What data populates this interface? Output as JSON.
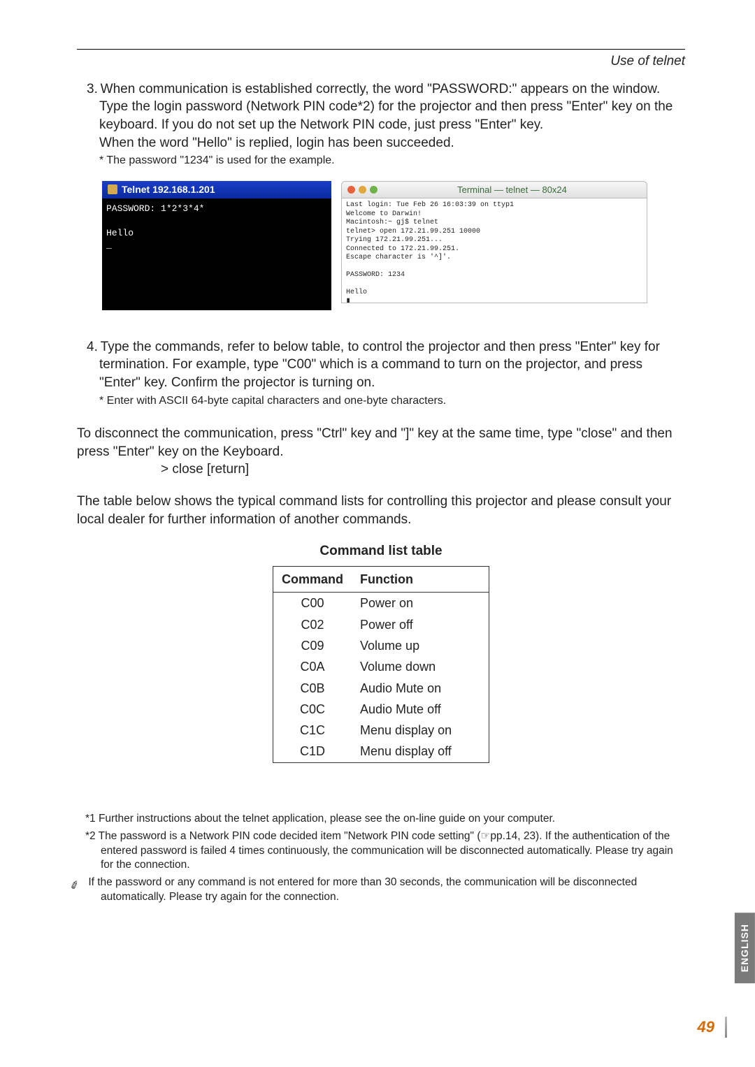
{
  "header": {
    "section": "Use of telnet"
  },
  "step3": {
    "text": "3. When communication is established correctly, the word \"PASSWORD:\" appears on the window. Type the login password (Network PIN code*2) for the projector and then press \"Enter\" key on the keyboard. If you do not set up the Network PIN code, just press \"Enter\" key.",
    "cont": "When the word \"Hello\" is replied, login has been succeeded.",
    "note": "* The password \"1234\" is used for the example."
  },
  "win_shot": {
    "title": "Telnet 192.168.1.201",
    "body": "PASSWORD: 1*2*3*4*\n\nHello\n_"
  },
  "mac_shot": {
    "title": "Terminal — telnet — 80x24",
    "body": "Last login: Tue Feb 26 16:03:39 on ttyp1\nWelcome to Darwin!\nMacintosh:~ gj$ telnet\ntelnet> open 172.21.99.251 10000\nTrying 172.21.99.251...\nConnected to 172.21.99.251.\nEscape character is '^]'.\n\nPASSWORD: 1234\n\nHello\n∎"
  },
  "step4": {
    "text": "4. Type the commands, refer to below table, to control the projector and then press \"Enter\" key for termination. For example, type \"C00\" which is a command to turn on the projector, and press \"Enter\" key. Confirm the projector is turning on.",
    "note": "* Enter with ASCII 64-byte capital characters and one-byte characters."
  },
  "disconnect": {
    "p": "To disconnect the communication, press \"Ctrl\" key and \"]\" key at the same time, type \"close\" and then press \"Enter\" key on the Keyboard.",
    "cmd": "> close [return]"
  },
  "intro_table": "The table below shows the typical command lists for controlling this projector and please consult your local dealer for further information of another commands.",
  "table": {
    "title": "Command list table",
    "headers": {
      "c1": "Command",
      "c2": "Function"
    },
    "rows": [
      {
        "cmd": "C00",
        "fn": "Power on"
      },
      {
        "cmd": "C02",
        "fn": "Power off"
      },
      {
        "cmd": "C09",
        "fn": "Volume up"
      },
      {
        "cmd": "C0A",
        "fn": "Volume down"
      },
      {
        "cmd": "C0B",
        "fn": "Audio Mute on"
      },
      {
        "cmd": "C0C",
        "fn": "Audio Mute off"
      },
      {
        "cmd": "C1C",
        "fn": "Menu display on"
      },
      {
        "cmd": "C1D",
        "fn": "Menu display off"
      }
    ]
  },
  "footnotes": {
    "f1": "*1 Further instructions about the telnet application, please see the on-line guide on your computer.",
    "f2": "*2 The password is a Network PIN code decided item \"Network PIN code setting\" (☞pp.14, 23). If the authentication of the entered password is failed 4 times continuously, the communication will be disconnected automatically. Please try again for the connection.",
    "note": "If the password or any command is not entered for more than 30 seconds, the communication will be disconnected automatically. Please try again for the connection."
  },
  "sidebar": "ENGLISH",
  "page": "49"
}
